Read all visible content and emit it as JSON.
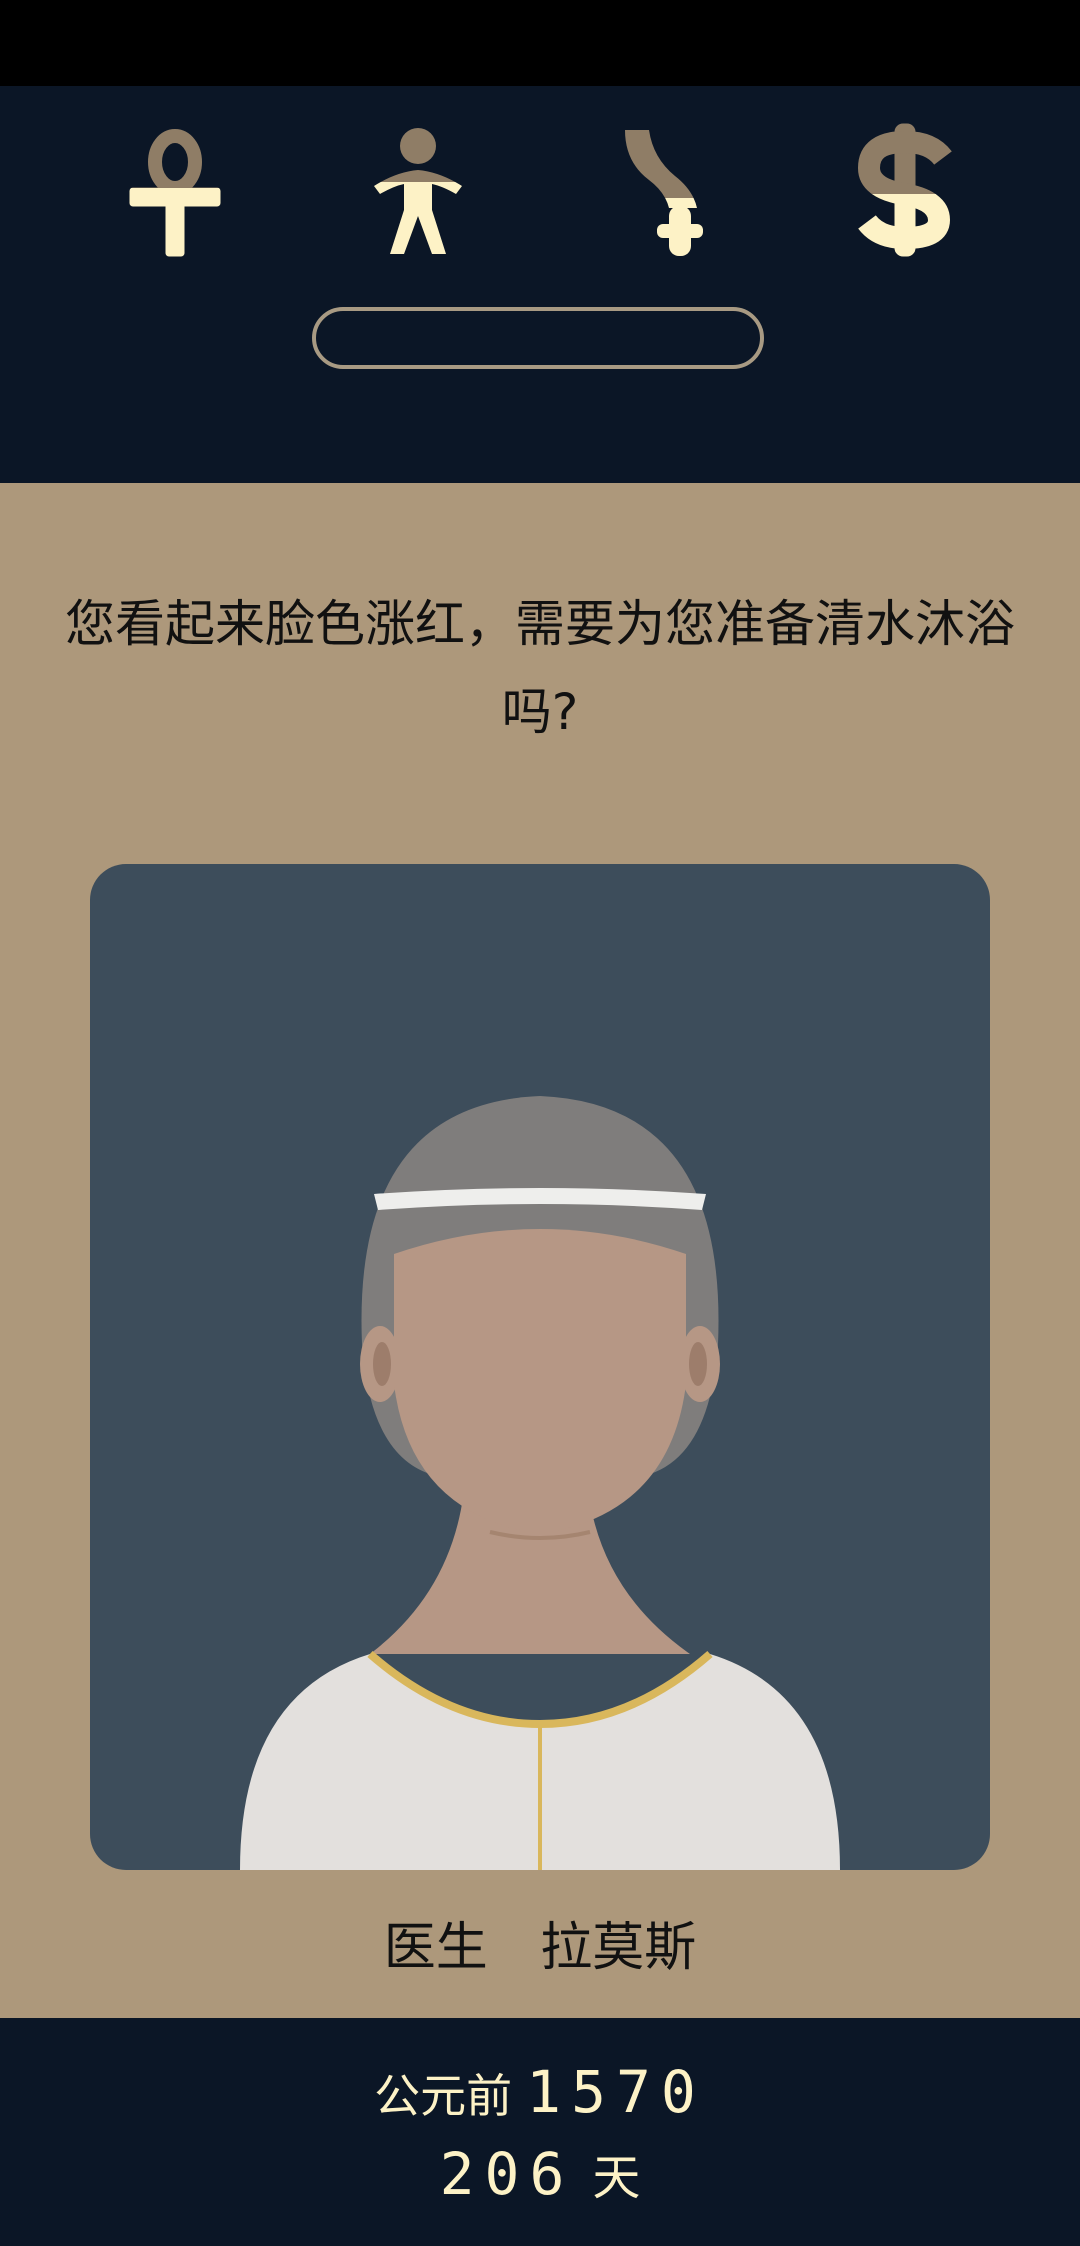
{
  "stats": [
    {
      "name": "religion",
      "icon": "ankh-icon",
      "level": 0.3
    },
    {
      "name": "people",
      "icon": "person-icon",
      "level": 0.45
    },
    {
      "name": "military",
      "icon": "khopesh-icon",
      "level": 0.35
    },
    {
      "name": "wealth",
      "icon": "dollar-icon",
      "level": 0.5
    }
  ],
  "colors": {
    "header_bg": "#0b1626",
    "card_bg": "#ad987b",
    "portrait_bg": "#3d4d5b",
    "icon_filled": "#fdf2c6",
    "icon_empty": "#8f7d66",
    "text_light": "#fdf2c6"
  },
  "question": "您看起来脸色涨红，需要为您准备清水沐浴吗?",
  "character": {
    "role": "医生",
    "name": "拉莫斯"
  },
  "footer": {
    "era_label": "公元前",
    "year": "1570",
    "days": "206",
    "days_unit": "天"
  }
}
